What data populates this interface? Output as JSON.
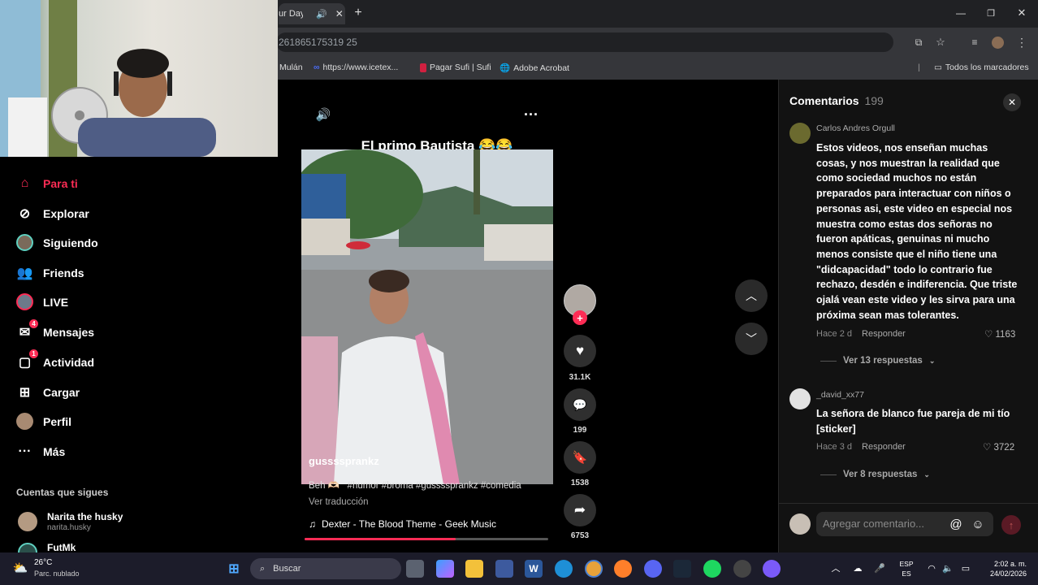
{
  "browser": {
    "tab_title": "ur Day",
    "url": "261865175319 25",
    "bookmarks": [
      {
        "label": "Mulán"
      },
      {
        "label": "https://www.icetex..."
      },
      {
        "label": "Pagar Sufi | Sufi"
      },
      {
        "label": "Adobe Acrobat"
      }
    ],
    "all_bookmarks": "Todos los marcadores"
  },
  "sidebar": {
    "items": [
      {
        "label": "Para ti",
        "icon": "home-icon",
        "active": true
      },
      {
        "label": "Explorar",
        "icon": "compass-icon"
      },
      {
        "label": "Siguiendo",
        "icon": "avatar-icon"
      },
      {
        "label": "Friends",
        "icon": "friends-icon"
      },
      {
        "label": "LIVE",
        "icon": "live-icon"
      },
      {
        "label": "Mensajes",
        "icon": "messages-icon",
        "badge": "4"
      },
      {
        "label": "Actividad",
        "icon": "activity-icon",
        "badge": "1"
      },
      {
        "label": "Cargar",
        "icon": "upload-icon"
      },
      {
        "label": "Perfil",
        "icon": "profile-icon"
      },
      {
        "label": "Más",
        "icon": "more-icon"
      }
    ],
    "following_heading": "Cuentas que sigues",
    "following": [
      {
        "name": "Narita the husky",
        "handle": "narita.husky"
      },
      {
        "name": "FutMk",
        "handle": ""
      }
    ]
  },
  "video": {
    "title": "El primo Bautista 😂😂",
    "author": "gussssprankz",
    "caption": "Beh 🫶🏻   #humor #broma #gussssprankz #comedia",
    "translate": "Ver traducción",
    "music": "Dexter - The Blood Theme - Geek Music",
    "progress": 0.62,
    "likes": "31.1K",
    "comments": "199",
    "saves": "1538",
    "shares": "6753"
  },
  "comments_panel": {
    "title": "Comentarios",
    "count": "199",
    "input_placeholder": "Agregar comentario...",
    "items": [
      {
        "user": "Carlos Andres Orgull",
        "text": "Estos videos, nos enseñan muchas cosas, y nos muestran la realidad que como sociedad muchos no están preparados para interactuar con niños o personas asi, este video en especial nos muestra como estas dos señoras no fueron apáticas, genuinas ni mucho menos consiste que el niño tiene una \"didcapacidad\" todo lo contrario fue rechazo, desdén e indiferencia. Que triste ojalá vean este video y les sirva para una próxima sean mas tolerantes.",
        "time": "Hace 2 d",
        "reply": "Responder",
        "likes": "1163",
        "replies": "Ver 13 respuestas"
      },
      {
        "user": "_david_xx77",
        "text": "La señora de blanco fue pareja de mi tío [sticker]",
        "time": "Hace 3 d",
        "reply": "Responder",
        "likes": "3722",
        "replies": "Ver 8 respuestas"
      }
    ]
  },
  "taskbar": {
    "weather_temp": "26°C",
    "weather_desc": "Parc. nublado",
    "search": "Buscar",
    "lang_top": "ESP",
    "lang_bottom": "ES",
    "time": "2:02 a. m.",
    "date": "24/02/2026"
  },
  "colors": {
    "accent": "#fe2c55",
    "panel": "#121212",
    "taskbar": "#1c1c2a"
  }
}
